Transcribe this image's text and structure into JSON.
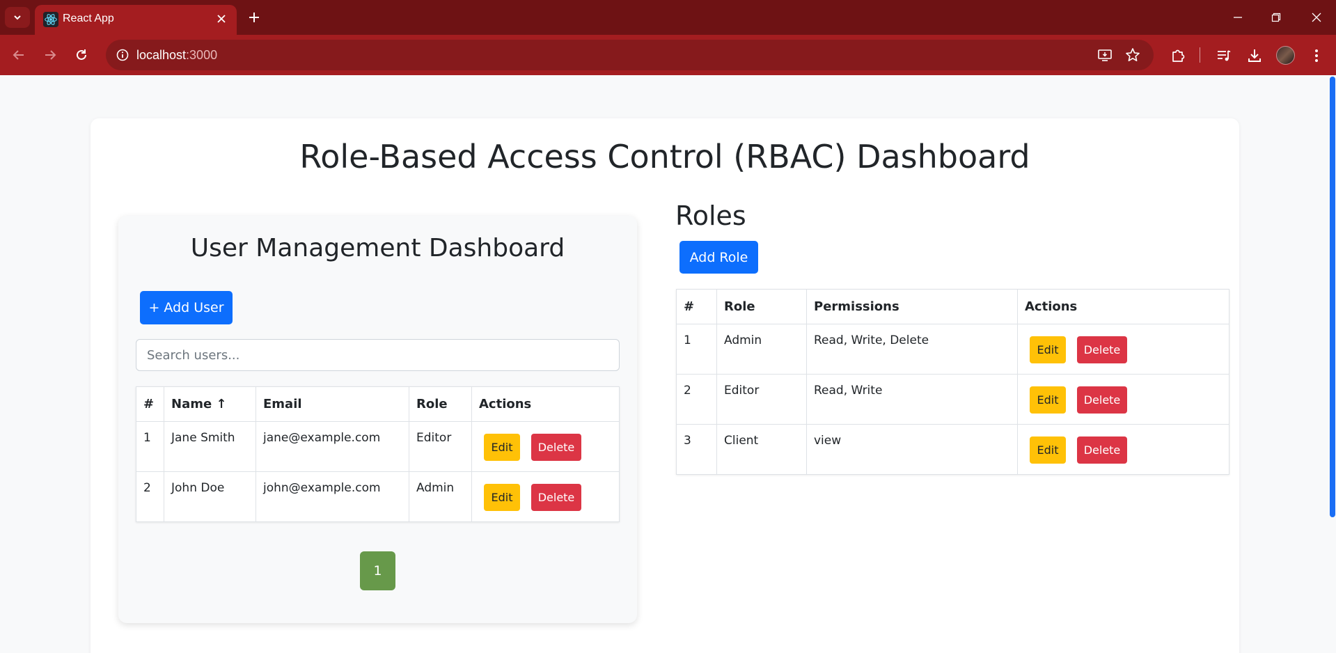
{
  "browser": {
    "tab_title": "React App",
    "url_host": "localhost",
    "url_port": ":3000"
  },
  "page": {
    "main_title": "Role-Based Access Control (RBAC) Dashboard"
  },
  "users": {
    "title": "User Management Dashboard",
    "add_button": "+ Add User",
    "search_placeholder": "Search users...",
    "columns": [
      "#",
      "Name ↑",
      "Email",
      "Role",
      "Actions"
    ],
    "rows": [
      {
        "num": "1",
        "name": "Jane Smith",
        "email": "jane@example.com",
        "role": "Editor"
      },
      {
        "num": "2",
        "name": "John Doe",
        "email": "john@example.com",
        "role": "Admin"
      }
    ],
    "edit_label": "Edit",
    "delete_label": "Delete",
    "page": "1"
  },
  "roles": {
    "title": "Roles",
    "add_button": "Add Role",
    "columns": [
      "#",
      "Role",
      "Permissions",
      "Actions"
    ],
    "rows": [
      {
        "num": "1",
        "role": "Admin",
        "permissions": "Read, Write, Delete"
      },
      {
        "num": "2",
        "role": "Editor",
        "permissions": "Read, Write"
      },
      {
        "num": "3",
        "role": "Client",
        "permissions": "view"
      }
    ],
    "edit_label": "Edit",
    "delete_label": "Delete"
  },
  "colors": {
    "primary": "#0d6efd",
    "edit": "#ffc107",
    "delete": "#dc3545",
    "pagination_active": "#67994a",
    "browser_frame": "#a41d20"
  },
  "icons": {
    "tab_menu": "chevron-down-icon",
    "favicon": "react-icon",
    "close": "close-icon",
    "new_tab": "plus-icon",
    "back": "back-arrow-icon",
    "forward": "forward-arrow-icon",
    "reload": "reload-icon",
    "site_info": "info-icon",
    "install": "install-app-icon",
    "bookmark": "star-icon",
    "extensions": "puzzle-icon",
    "media": "media-playlist-icon",
    "downloads": "download-icon",
    "menu": "kebab-menu-icon"
  }
}
